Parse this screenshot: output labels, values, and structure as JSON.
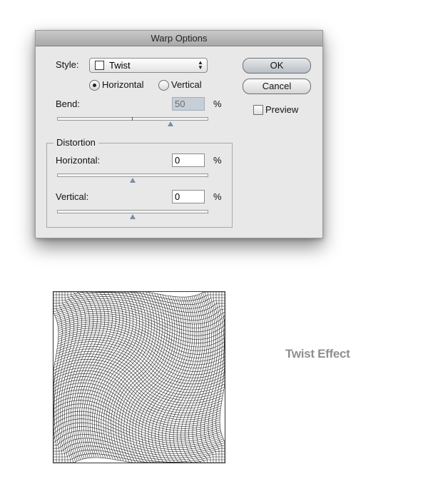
{
  "dialog": {
    "title": "Warp Options",
    "style": {
      "label": "Style:",
      "value": "Twist"
    },
    "orientation": {
      "options": [
        {
          "label": "Horizontal",
          "selected": true
        },
        {
          "label": "Vertical",
          "selected": false
        }
      ]
    },
    "bend": {
      "label": "Bend:",
      "value": "50",
      "unit": "%",
      "slider_percent": 50
    },
    "distortion": {
      "title": "Distortion",
      "horizontal": {
        "label": "Horizontal:",
        "value": "0",
        "unit": "%",
        "slider_percent": 0
      },
      "vertical": {
        "label": "Vertical:",
        "value": "0",
        "unit": "%",
        "slider_percent": 0
      }
    },
    "buttons": {
      "ok": "OK",
      "cancel": "Cancel"
    },
    "preview": {
      "label": "Preview",
      "checked": false
    }
  },
  "effect": {
    "label": "Twist Effect"
  },
  "colors": {
    "dialog_bg": "#e8e8e8",
    "slider_thumb": "#7a8ea4",
    "effect_text": "#8f8f8f"
  }
}
